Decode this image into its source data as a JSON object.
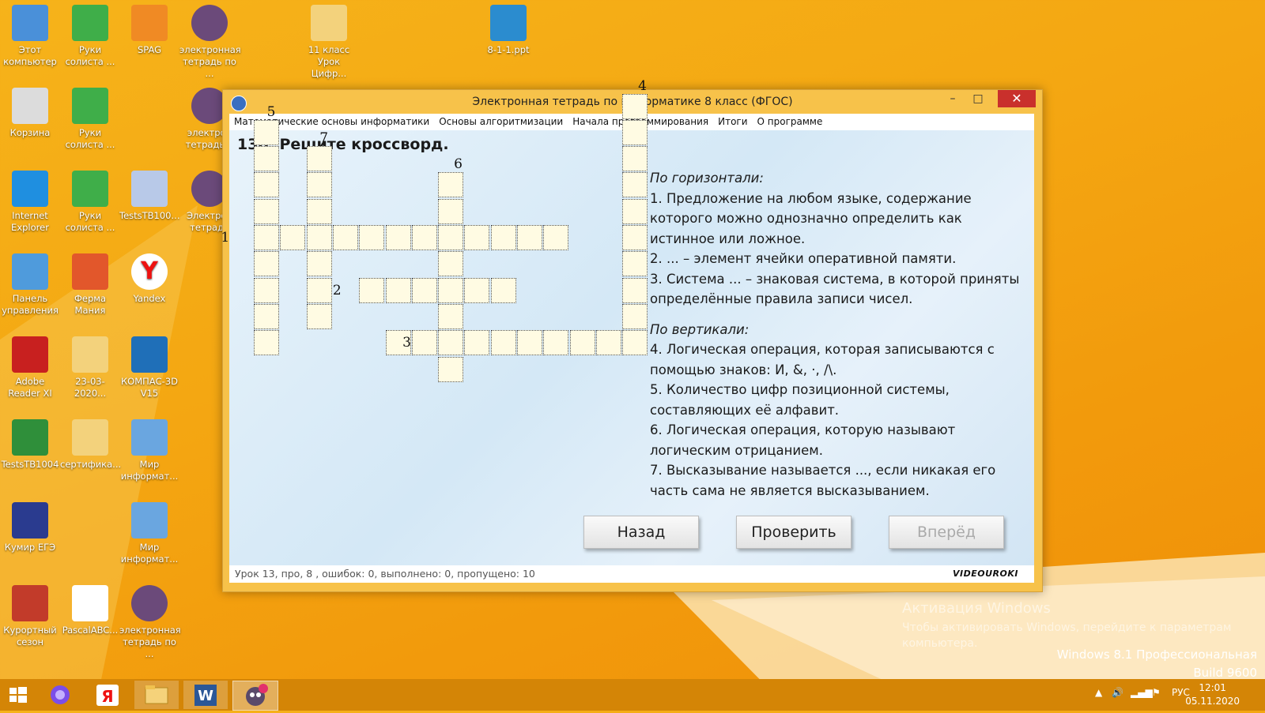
{
  "desktop_icons": [
    {
      "label": "Этот\nкомпьютер",
      "icon": "computer-icon"
    },
    {
      "label": "Руки\nсолиста ...",
      "icon": "hand-icon"
    },
    {
      "label": "SPAG",
      "icon": "paw-icon"
    },
    {
      "label": "электронная\nтетрадь по ...",
      "icon": "robot-7-icon"
    },
    {
      "label": "11 класс\nУрок Цифр...",
      "icon": "pdf-folder-icon"
    },
    {
      "label": "8-1-1.ppt",
      "icon": "ppt-icon"
    },
    {
      "label": "Корзина",
      "icon": "recycle-bin-icon"
    },
    {
      "label": "Руки\nсолиста ...",
      "icon": "hand-icon"
    },
    {
      "label": "электрон\nтетрадь п",
      "icon": "robot-8-icon"
    },
    {
      "label": "Internet\nExplorer",
      "icon": "ie-icon"
    },
    {
      "label": "Руки\nсолиста ...",
      "icon": "hand-icon"
    },
    {
      "label": "TestsTB100...",
      "icon": "disc-icon"
    },
    {
      "label": "Электрон\nтетрадь",
      "icon": "robot-5-icon"
    },
    {
      "label": "Панель\nуправления",
      "icon": "control-panel-icon"
    },
    {
      "label": "Ферма\nМания",
      "icon": "farm-icon"
    },
    {
      "label": "Yandex",
      "icon": "yandex-icon"
    },
    {
      "label": "Adobe\nReader XI",
      "icon": "adobe-icon"
    },
    {
      "label": "23-03-2020...",
      "icon": "folder-icon"
    },
    {
      "label": "КОМПАС-3D\nV15",
      "icon": "kompas-icon"
    },
    {
      "label": "TestsTB1004",
      "icon": "tb-icon"
    },
    {
      "label": "сертифика...",
      "icon": "folder-icon"
    },
    {
      "label": "Мир\nинформат...",
      "icon": "flower-icon"
    },
    {
      "label": "Кумир ЕГЭ",
      "icon": "kumir-icon"
    },
    {
      "label": "Мир\nинформат...",
      "icon": "flower-icon"
    },
    {
      "label": "Курортный\nсезон",
      "icon": "house-icon"
    },
    {
      "label": "PascalABC...",
      "icon": "abc-icon"
    },
    {
      "label": "электронная\nтетрадь по ...",
      "icon": "robot-6-icon"
    }
  ],
  "window": {
    "title": "Электронная тетрадь по информатике 8 класс (ФГОС)",
    "min": "–",
    "max": "□",
    "close": "✕"
  },
  "menu": [
    "Математические основы информатики",
    "Основы алгоритмизации",
    "Начала программирования",
    "Итоги",
    "О программе"
  ],
  "task": {
    "title": "130. Решите кроссворд."
  },
  "crossword": {
    "numbers": [
      "1",
      "2",
      "3",
      "4",
      "5",
      "6",
      "7"
    ]
  },
  "clues": {
    "horizontal_head": "По горизонтали:",
    "h1": "1. Предложение на любом языке, содержание которого можно однозначно определить как истинное или ложное.",
    "h2": "2. ... – элемент ячейки оперативной памяти.",
    "h3": "3. Система ... – знаковая система, в которой приняты определённые правила записи чисел.",
    "vertical_head": "По вертикали:",
    "v4": "4. Логическая операция, которая записываются с помощью знаков: И, &, ·, /\\.",
    "v5": "5. Количество цифр позиционной системы, составляющих её алфавит.",
    "v6": "6. Логическая операция, которую называют логическим отрицанием.",
    "v7": "7. Высказывание называется ..., если никакая его часть сама не является высказыванием."
  },
  "buttons": {
    "back": "Назад",
    "check": "Проверить",
    "forward": "Вперёд"
  },
  "status": {
    "text": "Урок 13, про, 8 , ошибок: 0, выполнено: 0, пропущено: 10",
    "logo": "VIDEOUROKI"
  },
  "activation": {
    "title": "Активация Windows",
    "text": "Чтобы активировать Windows, перейдите к параметрам компьютера."
  },
  "winver": {
    "line1": "Windows 8.1 Профессиональная",
    "line2": "Build 9600"
  },
  "taskbar": {
    "lang": "РУС",
    "time": "12:01",
    "date": "05.11.2020"
  },
  "colors": {
    "desktop": "#f4a712",
    "window_frame": "#f7c24a",
    "close": "#c9302c",
    "cell": "#fffbe3",
    "taskbar": "#d48506"
  }
}
